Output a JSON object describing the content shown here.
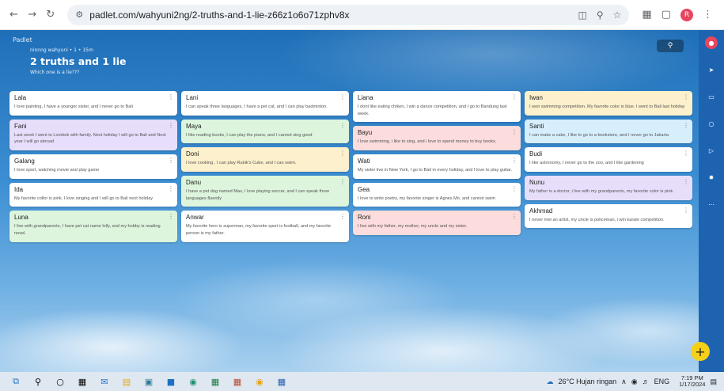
{
  "browser": {
    "url": "padlet.com/wahyuni2ng/2-truths-and-1-lie-z66z1o6o71zphv8x",
    "profile_initial": "R"
  },
  "padlet": {
    "brand": "Padlet",
    "author_line": "ninnng wahyuni • 1 • 15m",
    "title": "2 truths and 1 lie",
    "subtitle": "Which one is a lie???",
    "search_icon": "search-icon",
    "add_label": "+"
  },
  "columns": [
    [
      {
        "name": "Lala",
        "text": "I love painting, I have a younger sister, and I never go to Bali",
        "color": "white"
      },
      {
        "name": "Fani",
        "text": "Last week I went to Lombok with family. Next holiday I will go to Bali and Next year I will go abroad",
        "color": "purple"
      },
      {
        "name": "Galang",
        "text": "I love sport, watching movie and play game",
        "color": "white"
      },
      {
        "name": "Ida",
        "text": "My favorite collor is pink, I love singing and I will go to Bali next holiday",
        "color": "white"
      },
      {
        "name": "Luna",
        "text": "I live with grandparents, I have pet cat name lolly, and my hobby is reading novel.",
        "color": "green"
      }
    ],
    [
      {
        "name": "Lani",
        "text": "I can speak three languages, I have a pet cat, and I can play badminton.",
        "color": "white"
      },
      {
        "name": "Maya",
        "text": "I like reading books, I can play the piano, and I cannot sing good",
        "color": "green"
      },
      {
        "name": "Doni",
        "text": "I love cooking , I can play Rubik's Cube, and I can swim.",
        "color": "yellow"
      },
      {
        "name": "Danu",
        "text": "I have a pet dog named Max, I love playing soccer, and I can speak three languages fluently",
        "color": "green"
      },
      {
        "name": "Anwar",
        "text": "My favorite hero is superman, my favorite sport is football, and my favorite person is my father.",
        "color": "white"
      }
    ],
    [
      {
        "name": "Liana",
        "text": "I dont like eating chiken, I win a dance competition, and I go to Bandung last week.",
        "color": "white"
      },
      {
        "name": "Bayu",
        "text": "I love swimming, i like to sing, and i love to spend money to buy books.",
        "color": "red"
      },
      {
        "name": "Wati",
        "text": "My sister live in New York, I go to Bali in every holiday, and I love to play guitar.",
        "color": "white"
      },
      {
        "name": "Gea",
        "text": "I love to write poetry, my favorite singer is Agnes Mo, and cannot swim",
        "color": "white"
      },
      {
        "name": "Roni",
        "text": "I live with my father, my mother, my uncle and my sister.",
        "color": "red"
      }
    ],
    [
      {
        "name": "Iwan",
        "text": "I won swimming competition. My favorite color is blue. I went to Bali last holiday",
        "color": "yellow"
      },
      {
        "name": "Santi",
        "text": "I can make a cake, I like to go to a bookstore, and I never go to Jakarta",
        "color": "blue"
      },
      {
        "name": "Budi",
        "text": "I like astronomy, I never go to the zoo, and I like gardening",
        "color": "white"
      },
      {
        "name": "Nunu",
        "text": "My father is a doctor, i live with my grandparents, my favorite color is pink",
        "color": "purple"
      },
      {
        "name": "Akhmad",
        "text": "I never met an artist, my uncle is policeman, i win karate competition.",
        "color": "white"
      }
    ]
  ],
  "taskbar": {
    "weather": "26°C Hujan ringan",
    "lang": "ENG",
    "time": "7:19 PM",
    "date": "1/17/2024"
  }
}
